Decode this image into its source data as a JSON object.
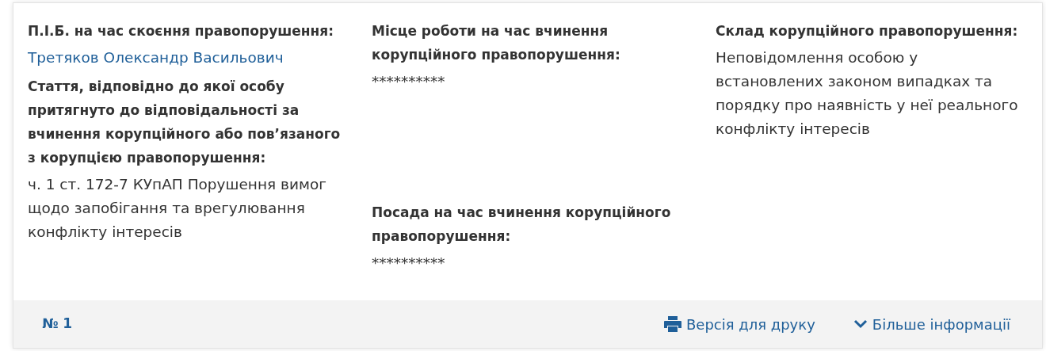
{
  "columns": [
    {
      "fields": [
        {
          "label": "П.І.Б. на час скоєння правопорушення:",
          "value": "Третяков Олександр Васильович",
          "kind": "link"
        },
        {
          "label": "Стаття, відповідно до якої особу притягнуто до відповідальності за вчинення корупційного або пов’язаного з корупцією правопорушення:",
          "value": "ч. 1 ст. 172-7 КУпАП Порушення вимог щодо запобігання та врегулювання конфлікту інтересів",
          "kind": "text"
        }
      ]
    },
    {
      "fields": [
        {
          "label": "Місце роботи на час вчинення корупційного правопорушення:",
          "value": "**********",
          "kind": "text"
        },
        {
          "label": "Посада на час вчинення корупційного правопорушення:",
          "value": "**********",
          "kind": "text"
        }
      ]
    },
    {
      "fields": [
        {
          "label": "Склад корупційного правопорушення:",
          "value": "Неповідомлення особою у встановлених законом випадках та порядку про наявність у неї реального конфлікту інтересів",
          "kind": "text"
        }
      ]
    }
  ],
  "footer": {
    "number": "№ 1",
    "actions": [
      {
        "label": "Версія для друку",
        "kind": "print"
      },
      {
        "label": "Більше інформації",
        "kind": "expand"
      }
    ]
  }
}
